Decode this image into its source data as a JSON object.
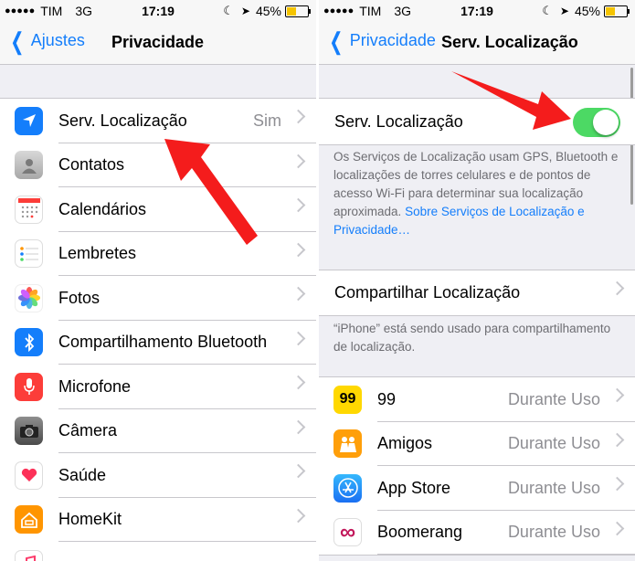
{
  "left": {
    "status": {
      "carrier": "TIM",
      "network": "3G",
      "time": "17:19",
      "battery": "45%"
    },
    "nav": {
      "back": "Ajustes",
      "title": "Privacidade"
    },
    "items": [
      {
        "label": "Serv. Localização",
        "value": "Sim",
        "icon": "location-arrow-icon",
        "color": "#147efb"
      },
      {
        "label": "Contatos",
        "value": "",
        "icon": "contacts-icon",
        "color": "#9b9b9b"
      },
      {
        "label": "Calendários",
        "value": "",
        "icon": "calendar-icon",
        "color": "#ffffff"
      },
      {
        "label": "Lembretes",
        "value": "",
        "icon": "reminders-icon",
        "color": "#ffffff"
      },
      {
        "label": "Fotos",
        "value": "",
        "icon": "photos-icon",
        "color": "#ffffff"
      },
      {
        "label": "Compartilhamento Bluetooth",
        "value": "",
        "icon": "bluetooth-icon",
        "color": "#147efb"
      },
      {
        "label": "Microfone",
        "value": "",
        "icon": "microphone-icon",
        "color": "#fc3d39"
      },
      {
        "label": "Câmera",
        "value": "",
        "icon": "camera-icon",
        "color": "#6b6b6b"
      },
      {
        "label": "Saúde",
        "value": "",
        "icon": "health-heart-icon",
        "color": "#ffffff"
      },
      {
        "label": "HomeKit",
        "value": "",
        "icon": "homekit-icon",
        "color": "#ff9500"
      }
    ]
  },
  "right": {
    "status": {
      "carrier": "TIM",
      "network": "3G",
      "time": "17:19",
      "battery": "45%"
    },
    "nav": {
      "back": "Privacidade",
      "title": "Serv. Localização"
    },
    "toggle": {
      "label": "Serv. Localização",
      "state": "on",
      "color": "#4cd964"
    },
    "description": "Os Serviços de Localização usam GPS, Bluetooth e localizações de torres celulares e de pontos de acesso Wi-Fi para determinar sua localização aproximada.",
    "description_link": "Sobre Serviços de Localização e Privacidade…",
    "share": {
      "label": "Compartilhar Localização"
    },
    "share_footer": "“iPhone” está sendo usado para compartilhamento de localização.",
    "apps": [
      {
        "label": "99",
        "value": "Durante Uso",
        "icon": "app-99-icon",
        "color": "#ffd800",
        "glyph": "99"
      },
      {
        "label": "Amigos",
        "value": "Durante Uso",
        "icon": "find-friends-icon",
        "color": "#ff9f0a",
        "glyph": ""
      },
      {
        "label": "App Store",
        "value": "Durante Uso",
        "icon": "app-store-icon",
        "color": "#1c8ef9",
        "glyph": ""
      },
      {
        "label": "Boomerang",
        "value": "Durante Uso",
        "icon": "boomerang-icon",
        "color": "#ffffff",
        "glyph": "∞"
      }
    ]
  },
  "colors": {
    "accent": "#147efb",
    "annotation_arrow": "#f41c1c"
  }
}
